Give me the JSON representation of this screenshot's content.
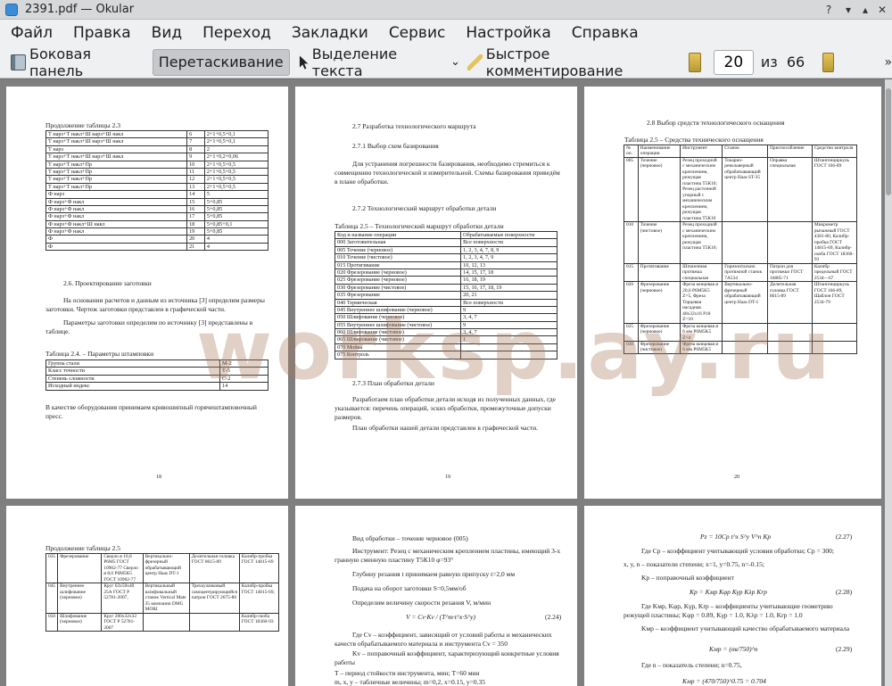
{
  "window": {
    "title": "2391.pdf — Okular"
  },
  "menu": [
    "Файл",
    "Правка",
    "Вид",
    "Переход",
    "Закладки",
    "Сервис",
    "Настройка",
    "Справка"
  ],
  "toolbar": {
    "sidebar": "Боковая панель",
    "drag": "Перетаскивание",
    "select_text": "Выделение текста",
    "quick_comment": "Быстрое комментирование",
    "page_current": "20",
    "page_of": "из",
    "page_total": "66"
  },
  "watermark": "worksp.ay.ru",
  "page18": {
    "heading": "Продолжение таблицы 2.3",
    "table_rows": [
      [
        "Т нарз+Т накл+Ш нарз+Ш накл",
        "6",
        "2+1+0,5+0,1"
      ],
      [
        "Т нарз+Т накл+Ш нарз+Ш накл",
        "7",
        "2+1+0,5+0,1"
      ],
      [
        "Т нарз",
        "8",
        "2"
      ],
      [
        "Т нарз+Т накл+Ш нарз+Ш накл",
        "9",
        "2+1+0,2+0,06"
      ],
      [
        "Т нарз+Т накл+Пр",
        "10",
        "2+1+0,5+0,5"
      ],
      [
        "Т нарз+Т накл+Пр",
        "11",
        "2+1+0,5+0,5"
      ],
      [
        "Т нарз+Т накл+Пр",
        "12",
        "2+1+0,5+0,5"
      ],
      [
        "Т нарз+Т накл+Пр",
        "13",
        "2+1+0,5+0,5"
      ],
      [
        "Ф нарз",
        "14",
        "5"
      ],
      [
        "Ф нарз+Ф накл",
        "15",
        "5+0,85"
      ],
      [
        "Ф нарз+Ф накл",
        "16",
        "5+0,85"
      ],
      [
        "Ф нарз+Ф накл",
        "17",
        "5+0,85"
      ],
      [
        "Ф нарз+Ф накл+Ш накл",
        "18",
        "5+0,85+0,1"
      ],
      [
        "Ф нарз+Ф накл",
        "19",
        "5+0,85"
      ],
      [
        "Ф",
        "20",
        "4"
      ],
      [
        "Ф",
        "21",
        "4"
      ]
    ],
    "section": "2.6. Проектирование заготовки",
    "para1": "На основании расчетов и данным из источника [3] определим размеры заготовки. Чертеж заготовки представлен в графической части.",
    "para2": "Параметры заготовки определим по источнику [3] представлены в таблице.",
    "table_caption": "Таблица 2.4. – Параметры штамповки",
    "params": [
      [
        "Группа стали",
        "М-2"
      ],
      [
        "Класс точности",
        "Т-5"
      ],
      [
        "Степень сложности",
        "С-2"
      ],
      [
        "Исходный индекс",
        "14"
      ]
    ],
    "para3": "В качестве оборудования принимаем кривошипный горячештамповочный пресс.",
    "page_number": "18"
  },
  "page19": {
    "h1": "2.7 Разработка технологического маршрута",
    "h2": "2.7.1 Выбор схем базирования",
    "para1": "Для устранения погрешности базирования, необходимо стремиться к совмещению технологической и измерительной. Схемы базирования приведём в плане обработки.",
    "h3": "2.7.2 Технологический маршрут обработки детали",
    "table_caption": "Таблица 2.5 – Технологический маршрут обработки детали",
    "table_head": [
      "Код и название операции",
      "Обрабатываемые поверхности"
    ],
    "table_rows": [
      [
        "000 Заготовительная",
        "Все поверхности"
      ],
      [
        "005 Точение (черновое)",
        "1, 2, 3, 4, 7, 8, 9"
      ],
      [
        "010 Точение (чистовое)",
        "1, 2, 3, 4, 7, 9"
      ],
      [
        "015 Протягивание",
        "10, 12, 13"
      ],
      [
        "020 Фрезерование (черновое)",
        "14, 15, 17, 18"
      ],
      [
        "025 Фрезерование (черновое)",
        "16, 18, 19"
      ],
      [
        "030 Фрезерование (чистовое)",
        "15, 16, 17, 18, 19"
      ],
      [
        "035 Фрезерование",
        "20, 21"
      ],
      [
        "040 Термическая",
        "Все поверхности"
      ],
      [
        "045 Внутреннее шлифование (черновое)",
        "9"
      ],
      [
        "050 Шлифование (черновое)",
        "3, 4, 7"
      ],
      [
        "055 Внутреннее шлифование (чистовое)",
        "9"
      ],
      [
        "060 Шлифование (чистовое)",
        "3, 4, 7"
      ],
      [
        "065 Шлифование (чистовое)",
        "1"
      ],
      [
        "070 Мойка",
        ""
      ],
      [
        "075 Контроль",
        ""
      ]
    ],
    "h4": "2.7.3 План обработки детали",
    "para2": "Разработаем план обработки детали исходя из полученных данных, где указывается: перечень операций, эскиз обработки, промежуточные допуски размеров.",
    "para3": "План обработки нашей детали представлен в графической части.",
    "page_number": "19"
  },
  "page20": {
    "h1": "2.8 Выбор средств технологического оснащения",
    "table_caption": "Таблица 2.5 – Средства технического оснащения",
    "head": [
      "№ оп.",
      "Наименование операции",
      "Инструмент",
      "Станок",
      "Приспособление",
      "Средство контроля"
    ],
    "rows": [
      [
        "005",
        "Точение (черновое)",
        "Резец проходной с механическим креплением, режущая пластина Т5К10; Резец расточной упорный с механическим креплением, режущая пластина Т5К10",
        "Токарно-револьверный обрабатывающий центр Haas ST-35",
        "Оправка специальная",
        "Штангенциркуль ГОСТ 166-89"
      ],
      [
        "010",
        "Точение (чистовое)",
        "Резец проходной с механическим креплением, режущая пластина Т5К10;",
        "",
        "",
        "Микрометр рычажный ГОСТ 4381-80, Калибр-пробка ГОСТ 14815-69, Калибр-скоба ГОСТ 18360-93"
      ],
      [
        "015",
        "Протягивание",
        "Шпоночная протяжка специальная",
        "Горизонтально протяжной станок 7А534",
        "Патрон для протяжки ГОСТ 16885-71",
        "Калибр предельный ГОСТ 2534—67"
      ],
      [
        "020",
        "Фрезерование (черновое)",
        "Фреза концевая ø 20,0 P6M5K5 Z=5, Фреза Торцевая насадная 40х32х16 P18 Z=10",
        "Вертикально-фрезерный обрабатывающий центр Haas DT-1",
        "Делительная головка ГОСТ 8615-89",
        "Штангенциркуль ГОСТ 166-89, Шаблон ГОСТ 2534-79"
      ],
      [
        "025",
        "Фрезерование (черновое)",
        "Фреза концевая ø 6 мм P6M5K5 Z=4",
        "",
        "",
        ""
      ],
      [
        "030",
        "Фрезерование (чистовое)",
        "Фреза концевая ø 6 мм P6M5K5",
        "",
        "",
        ""
      ]
    ],
    "page_number": "20"
  },
  "page21": {
    "heading": "Продолжение таблицы 2.5",
    "rows": [
      [
        "035",
        "Фрезерование",
        "Сверло ø 10,6 Р6М5 ГОСТ 10902-77 Сверло ø 8,0 Р6М5К5 ГОСТ 10902-77",
        "Вертикально-фрезерный обрабатывающий центр Haas DT-1",
        "Делительная головка ГОСТ 8615-89",
        "Калибр-пробка ГОСТ 14815-69"
      ],
      [
        "045",
        "Внутреннее шлифование (черновое)",
        "Круг 63х50х40 25А ГОСТ Р 52781-2007,",
        "Вертикальный шлифовальный станок Vertical Mate 35 компании DMG MORI",
        "Трехкулачковый самоцентрирующийся патрон ГОСТ 2675-80",
        "Калибр-пробка ГОСТ 14815-69,"
      ],
      [
        "050",
        "Шлифование (черновое)",
        "Круг 200х32х32 ГОСТ Р 52781-2007",
        "",
        "",
        "Калибр-скоба ГОСТ 18360-93"
      ]
    ]
  },
  "page22": {
    "line1": "Вид обработки – точение черновое (005)",
    "line2": "Инструмент: Резец с механическим креплением пластины, имеющий 3-х гранную сменную пластину Т5К10 φ=93°",
    "line3": "Глубину резания t принимаем равную припуску t=2,0 мм",
    "line4": "Подача на оборот заготовки S=0,5мм/об",
    "line5": "Определим величину скорости резания V, м/мин",
    "formula": "V = Cv·Kv / (T^m·t^x·S^y)",
    "eq": "(2.24)",
    "line6": "Где Cv – коэффициент, зависящий от условий работы и механических качеств обрабатываемого материала и инструмента Cv = 350",
    "line7": "Kv – поправочный коэффициент, характеризующий конкретные условия работы",
    "line8": "T – период стойкости инструмента, мин; T=60 мин",
    "line9": "m, x, y – табличные величины; m=0,2, x=0.15, y=0.35"
  },
  "page23": {
    "f1": "Pz = 10Cp t^x S^y V^n Kp",
    "e1": "(2.27)",
    "l1": "Где Cp – коэффициент учитывающий условия обработки; Cp = 300;",
    "l2": "x, y, n – показатели степени; x=1, y=0.75, n=-0.15;",
    "l3": "Kp – поправочный коэффициент",
    "f2": "Kp = Kмр Kφр Kγр Kλр Krp",
    "e2": "(2.28)",
    "l4": "Где Kмр, Kφр, Kγр, Krp – коэффициенты учитывающие геометрию режущей пластины; Kφр = 0.89, Kγр = 1.0, Kλр = 1.0, Krp = 1.0",
    "l5": "Kмр – коэффициент учитывающий качество обрабатываемого материала",
    "f3": "Kмр = (σв/750)^n",
    "e3": "(2.29)",
    "l6": "Где n – показатель степени; n=0.75,",
    "f4": "Kмр = (470/750)^0.75 = 0.704"
  }
}
